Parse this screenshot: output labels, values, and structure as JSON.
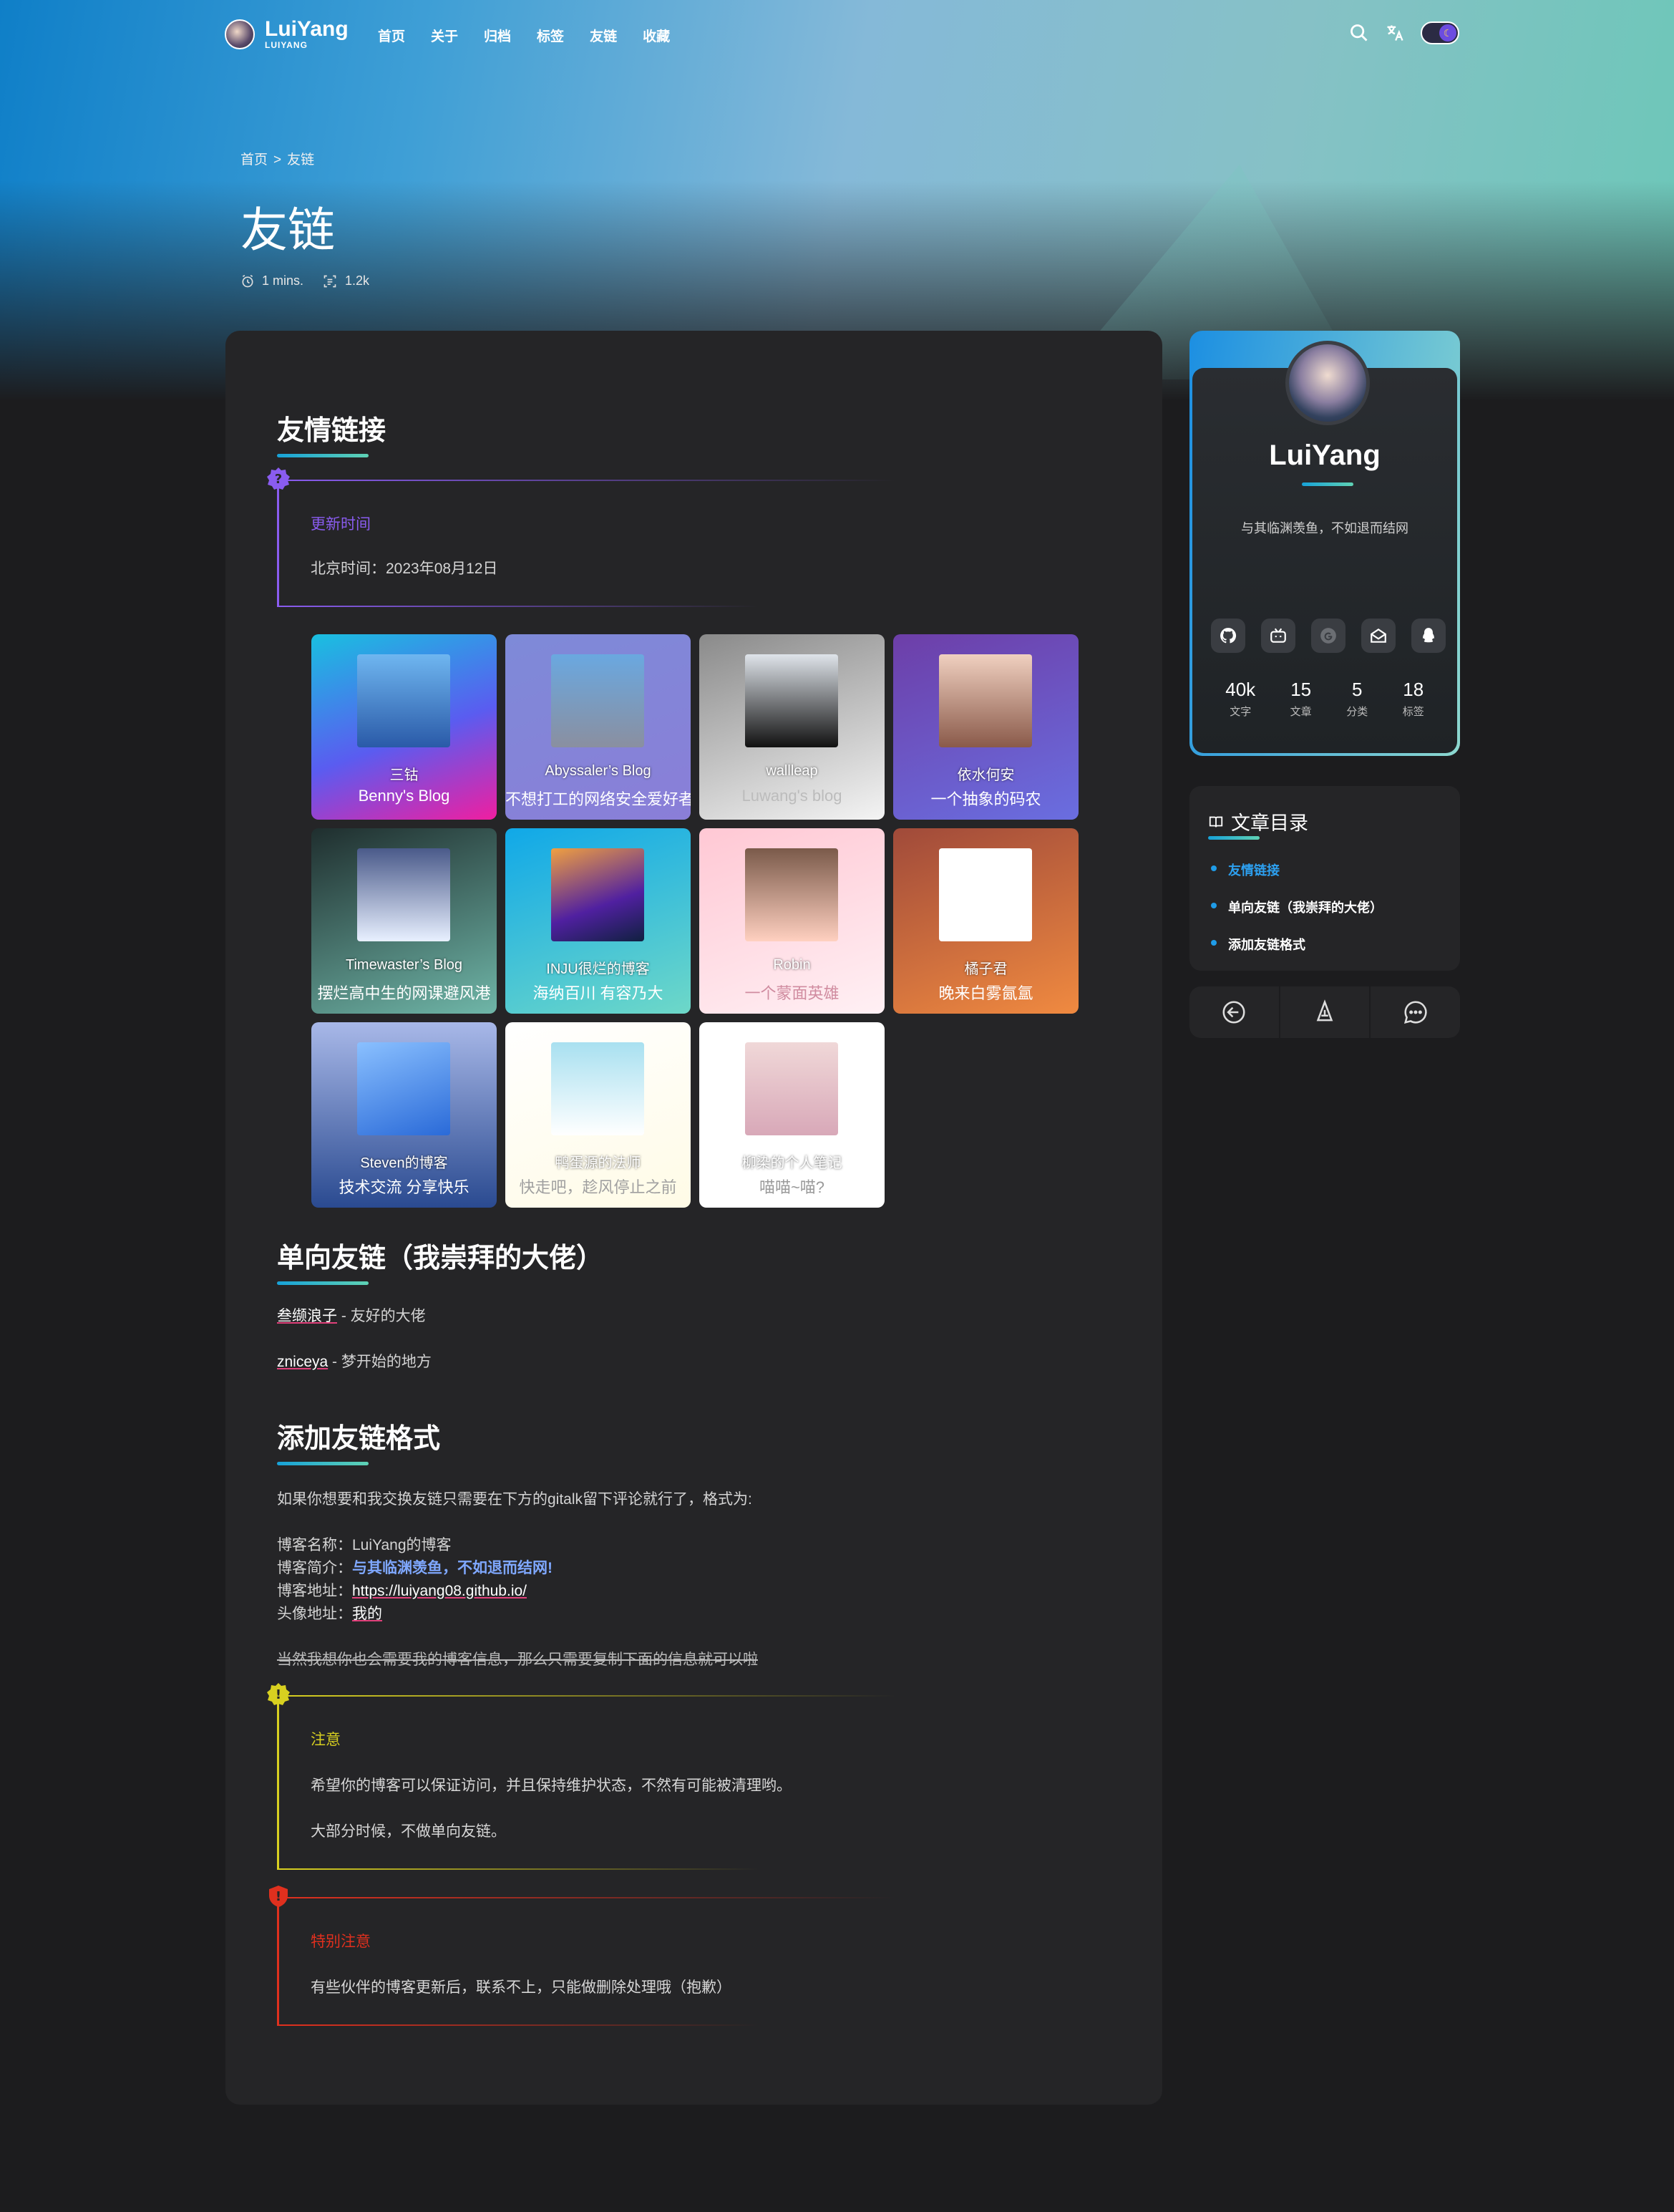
{
  "header": {
    "brand_name": "LuiYang",
    "brand_sub": "LUIYANG",
    "nav": [
      "首页",
      "关于",
      "归档",
      "标签",
      "友链",
      "收藏"
    ]
  },
  "breadcrumb": {
    "home": "首页",
    "sep": ">",
    "current": "友链"
  },
  "page": {
    "title": "友链",
    "read_time": "1 mins.",
    "word_count": "1.2k"
  },
  "sections": {
    "friends_heading": "友情链接",
    "update_note": {
      "title": "更新时间",
      "text": "北京时间：2023年08月12日"
    },
    "oneway_heading": "单向友链（我崇拜的大佬）",
    "oneway_items": [
      {
        "name": "叁缬浪子",
        "desc": " - 友好的大佬"
      },
      {
        "name": "zniceya",
        "desc": " - 梦开始的地方"
      }
    ],
    "add_heading": "添加友链格式",
    "add_intro": "如果你想要和我交换友链只需要在下方的gitalk留下评论就行了，格式为:",
    "format": {
      "name_label": "博客名称：",
      "name_value": "LuiYang的博客",
      "desc_label": "博客简介：",
      "desc_value": "与其临渊羡鱼，不如退而结网!",
      "url_label": "博客地址：",
      "url_value": "https://luiyang08.github.io/",
      "avatar_label": "头像地址：",
      "avatar_value": "我的"
    },
    "strike_text": "当然我想你也会需要我的博客信息，那么只需要复制下面的信息就可以啦",
    "warn_note": {
      "title": "注意",
      "line1": "希望你的博客可以保证访问，并且保持维护状态，不然有可能被清理哟。",
      "line2": "大部分时候，不做单向友链。"
    },
    "danger_note": {
      "title": "特别注意",
      "text": "有些伙伴的博客更新后，联系不上，只能做删除处理哦（抱歉）"
    }
  },
  "friends": [
    {
      "name": "三钴",
      "desc": "Benny's Blog",
      "bg": "linear-gradient(160deg,#19c0e0,#5a5cf0 55%,#f01ea0)",
      "desc_color": "#ffffff",
      "avatar": "linear-gradient(180deg,#6fb6f0,#2a5aa8)"
    },
    {
      "name": "Abyssaler’s Blog",
      "desc": "不想打工的网络安全爱好者",
      "bg": "linear-gradient(160deg,#7e8ad8,#8a7ed8)",
      "desc_color": "#ffffff",
      "avatar": "linear-gradient(180deg,#6aa8e0,#8a8fa0)"
    },
    {
      "name": "wallleap",
      "desc": "Luwang's blog",
      "bg": "linear-gradient(160deg,#8a8a8a,#f4f4f4)",
      "desc_color": "#bcbcbc",
      "avatar": "linear-gradient(180deg,#dfe4ea,#111)"
    },
    {
      "name": "依水何安",
      "desc": "一个抽象的码农",
      "bg": "linear-gradient(160deg,#6d3ea8,#6a6ee0)",
      "desc_color": "#ffffff",
      "avatar": "linear-gradient(180deg,#f0d0c0,#8a5a4a)"
    },
    {
      "name": "Timewaster’s Blog",
      "desc": "摆烂高中生的网课避风港",
      "bg": "linear-gradient(160deg,#1f2e2e,#6fb6a8)",
      "desc_color": "#ffffff",
      "avatar": "linear-gradient(180deg,#4a5a8a,#e8f0ff)"
    },
    {
      "name": "INJU很烂的博客",
      "desc": "海纳百川 有容乃大",
      "bg": "linear-gradient(160deg,#10a8e8,#6ed8c8)",
      "desc_color": "#ffffff",
      "avatar": "linear-gradient(160deg,#f0a040,#5020a0 60%,#102040)"
    },
    {
      "name": "Robin",
      "desc": "一个蒙面英雄",
      "bg": "linear-gradient(160deg,#ffc8d4,#fff0f4)",
      "desc_color": "#d08ca0",
      "avatar": "linear-gradient(180deg,#7a5a4a,#ffd0c0)"
    },
    {
      "name": "橘子君",
      "desc": "晚来白雾氤氲",
      "bg": "linear-gradient(160deg,#a04a3a,#f08a40)",
      "desc_color": "#ffffff",
      "avatar": "linear-gradient(180deg,#ffffff,#ffffff)"
    },
    {
      "name": "Steven的博客",
      "desc": "技术交流 分享快乐",
      "bg": "linear-gradient(180deg,#a8b8e8,#2a4a90)",
      "desc_color": "#ffffff",
      "avatar": "linear-gradient(160deg,#8ac0ff,#2a6ad8)"
    },
    {
      "name": "鸭蛋源的法师",
      "desc": "快走吧，趁风停止之前",
      "bg": "linear-gradient(160deg,#ffffff,#fffbe6)",
      "desc_color": "#a0a0a0",
      "avatar": "linear-gradient(180deg,#a8e0f0,#ffffff)"
    },
    {
      "name": "柳染的个人笔记",
      "desc": "喵喵~喵?",
      "bg": "linear-gradient(160deg,#ffffff,#ffffff)",
      "desc_color": "#9a9a9a",
      "avatar": "linear-gradient(180deg,#f0d8d8,#d8a8b8)"
    }
  ],
  "profile": {
    "name": "LuiYang",
    "motto": "与其临渊羡鱼，不如退而结网",
    "socials": [
      "github-icon",
      "bilibili-icon",
      "google-icon",
      "mail-icon",
      "qq-icon"
    ],
    "stats": [
      {
        "num": "40k",
        "label": "文字"
      },
      {
        "num": "15",
        "label": "文章"
      },
      {
        "num": "5",
        "label": "分类"
      },
      {
        "num": "18",
        "label": "标签"
      }
    ]
  },
  "toc": {
    "title": "文章目录",
    "items": [
      "友情链接",
      "单向友链（我崇拜的大佬）",
      "添加友链格式"
    ]
  },
  "colors": {
    "accent": "#1f9ce8",
    "info_purple": "#8a5cf0",
    "warn_yellow": "#d8d020",
    "danger_red": "#e0301e"
  }
}
